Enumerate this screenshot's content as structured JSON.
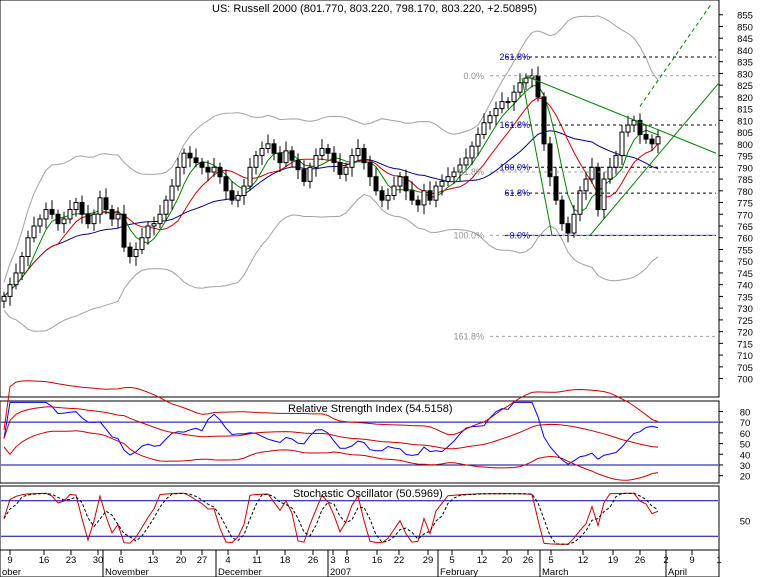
{
  "chart_data": [
    {
      "type": "candlestick",
      "title": "US: Russell 2000 (801.770, 803.220, 798.170, 803.220, +2.50895)",
      "y_ticks": [
        700,
        705,
        710,
        715,
        720,
        725,
        730,
        735,
        740,
        745,
        750,
        755,
        760,
        765,
        770,
        775,
        780,
        785,
        790,
        795,
        800,
        805,
        810,
        815,
        820,
        825,
        830,
        835,
        840,
        845,
        850,
        855
      ],
      "ylim": [
        693,
        860
      ],
      "grid": false,
      "series": [
        {
          "name": "close",
          "values": [
            735,
            740,
            745,
            752,
            760,
            765,
            768,
            772,
            770,
            766,
            768,
            772,
            775,
            770,
            766,
            770,
            777,
            772,
            768,
            770,
            756,
            752,
            755,
            760,
            765,
            766,
            770,
            776,
            782,
            790,
            796,
            794,
            792,
            790,
            788,
            790,
            786,
            780,
            776,
            778,
            782,
            790,
            795,
            798,
            800,
            796,
            792,
            797,
            793,
            789,
            784,
            790,
            795,
            798,
            796,
            792,
            787,
            790,
            795,
            798,
            792,
            786,
            780,
            776,
            778,
            782,
            786,
            780,
            776,
            774,
            780,
            776,
            782,
            784,
            786,
            788,
            791,
            794,
            799,
            804,
            809,
            812,
            815,
            818,
            818,
            822,
            826,
            828,
            829,
            820,
            800,
            786,
            776,
            766,
            762,
            770,
            780,
            785,
            790,
            772,
            785,
            790,
            795,
            805,
            808,
            810,
            804,
            802,
            800,
            803
          ]
        }
      ],
      "fib_levels": [
        {
          "label": "261.8%",
          "value": 837
        },
        {
          "label": "161.8%",
          "value": 808
        },
        {
          "label": "100.0%",
          "value": 790
        },
        {
          "label": "61.8%",
          "value": 779
        },
        {
          "label": "0.0%",
          "value": 761
        }
      ],
      "fib_left_labels": [
        {
          "label": "0.0%",
          "value": 829
        },
        {
          "label": "61.8%",
          "value": 788
        },
        {
          "label": "100.0%",
          "value": 761
        },
        {
          "label": "161.8%",
          "value": 718
        }
      ]
    },
    {
      "type": "line",
      "title": "Relative Strength Index (54.5158)",
      "y_ticks": [
        20,
        30,
        40,
        50,
        60,
        70,
        80
      ],
      "ylim": [
        15,
        87
      ],
      "reference_lines": [
        70,
        30
      ]
    },
    {
      "type": "line",
      "title": "Stochastic Oscillator (50.5969)",
      "y_ticks": [
        50
      ]
    }
  ],
  "x_axis": {
    "ticks": [
      "9",
      "16",
      "23",
      "30",
      "6",
      "13",
      "20",
      "27",
      "4",
      "11",
      "18",
      "26",
      "3",
      "8",
      "16",
      "22",
      "29",
      "5",
      "12",
      "20",
      "26",
      "5",
      "12",
      "19",
      "26",
      "2",
      "9",
      "1"
    ],
    "months": [
      "ober",
      "November",
      "December",
      "2007",
      "February",
      "March",
      "April"
    ]
  },
  "colors": {
    "price": "#000000",
    "ma_fast": "#008000",
    "ma_mid": "#cc0000",
    "ma_slow": "#000080",
    "bands": "#a0a0a0",
    "rsi": "#0000ff",
    "stoch_k": "#cc0000",
    "ref_line": "#0000aa"
  }
}
